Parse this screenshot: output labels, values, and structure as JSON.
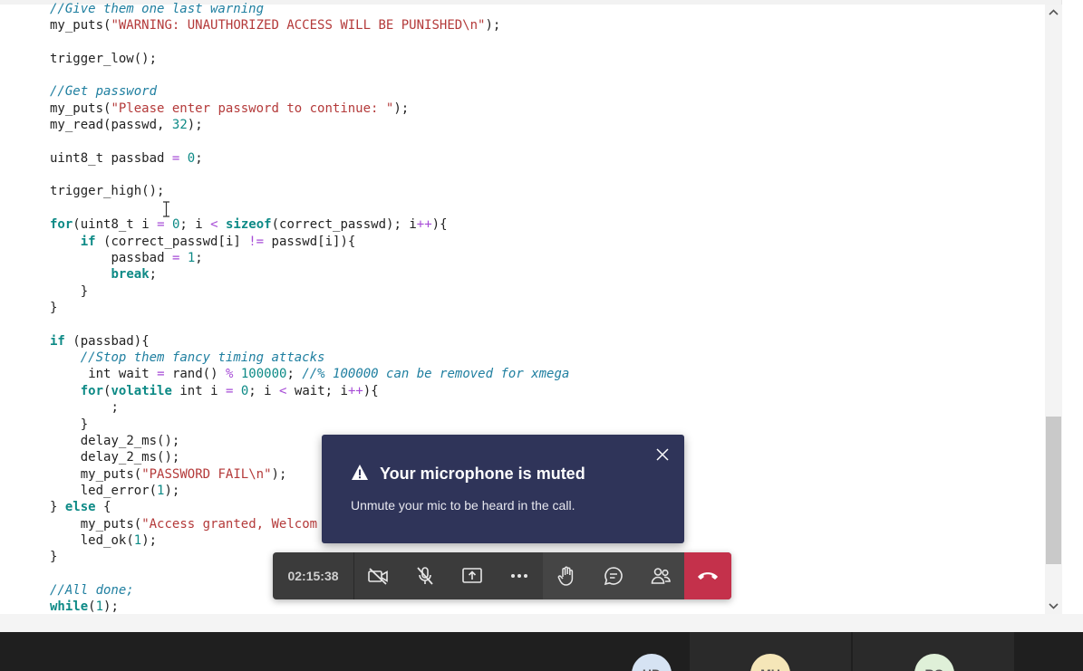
{
  "code": {
    "lines": [
      "//Give them one last warning",
      "my_puts(\"WARNING: UNAUTHORIZED ACCESS WILL BE PUNISHED\\n\");",
      "trigger_low();",
      "//Get password",
      "my_puts(\"Please enter password to continue: \");",
      "my_read(passwd, 32);",
      "uint8_t passbad = 0;",
      "trigger_high();",
      "for(uint8_t i = 0; i < sizeof(correct_passwd); i++){",
      "    if (correct_passwd[i] != passwd[i]){",
      "        passbad = 1;",
      "        break;",
      "    }",
      "}",
      "if (passbad){",
      "    //Stop them fancy timing attacks",
      "     int wait = rand() % 100000; //% 100000 can be removed for xmega",
      "    for(volatile int i = 0; i < wait; i++){",
      "        ;",
      "    }",
      "    delay_2_ms();",
      "    delay_2_ms();",
      "    my_puts(\"PASSWORD FAIL\\n\");",
      "    led_error(1);",
      "} else {",
      "    my_puts(\"Access granted, Welcom",
      "    led_ok(1);",
      "}",
      "//All done;",
      "while(1);"
    ]
  },
  "notification": {
    "title": "Your microphone is muted",
    "message": "Unmute your mic to be heard in the call."
  },
  "call_controls": {
    "timer": "02:15:38"
  },
  "participants": [
    {
      "initials": "HD",
      "color": "#d6e3f3"
    },
    {
      "initials": "MU",
      "color": "#f5e6b8"
    },
    {
      "initials": "RG",
      "color": "#dff0d8"
    }
  ],
  "colors": {
    "toast_bg": "#2f3459",
    "hangup": "#c4314b",
    "call_bar": "#3b3b3b"
  }
}
